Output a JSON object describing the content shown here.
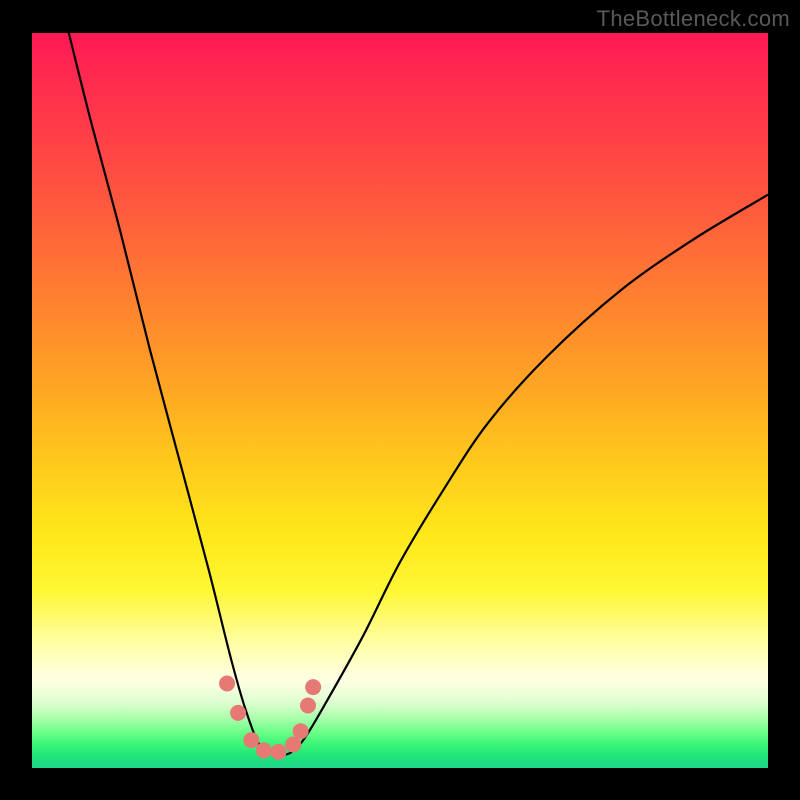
{
  "watermark": "TheBottleneck.com",
  "colors": {
    "frame": "#000000",
    "dot": "#e77974",
    "curve": "#000000"
  },
  "chart_data": {
    "type": "line",
    "title": "",
    "xlabel": "",
    "ylabel": "",
    "ylim": [
      0,
      100
    ],
    "xlim": [
      0,
      100
    ],
    "note": "Axes are unlabeled; values are estimated from pixel positions. y = bottleneck percentage (0 at bottom / green, 100 at top / red). Curve is a V shape with minimum near x≈32.",
    "series": [
      {
        "name": "bottleneck-curve",
        "x": [
          5,
          8,
          12,
          16,
          20,
          24,
          27,
          29,
          31,
          33,
          35,
          37,
          40,
          45,
          50,
          56,
          62,
          70,
          80,
          90,
          100
        ],
        "y": [
          100,
          88,
          73,
          57,
          42,
          27,
          15,
          8,
          3,
          2,
          2,
          4,
          9,
          18,
          28,
          38,
          47,
          56,
          65,
          72,
          78
        ]
      }
    ],
    "markers": {
      "name": "highlight-dots",
      "x": [
        26.5,
        28.0,
        29.8,
        31.5,
        33.5,
        35.5,
        36.5,
        37.5,
        38.2
      ],
      "y": [
        11.5,
        7.5,
        3.8,
        2.4,
        2.2,
        3.2,
        5.0,
        8.5,
        11.0
      ]
    }
  }
}
